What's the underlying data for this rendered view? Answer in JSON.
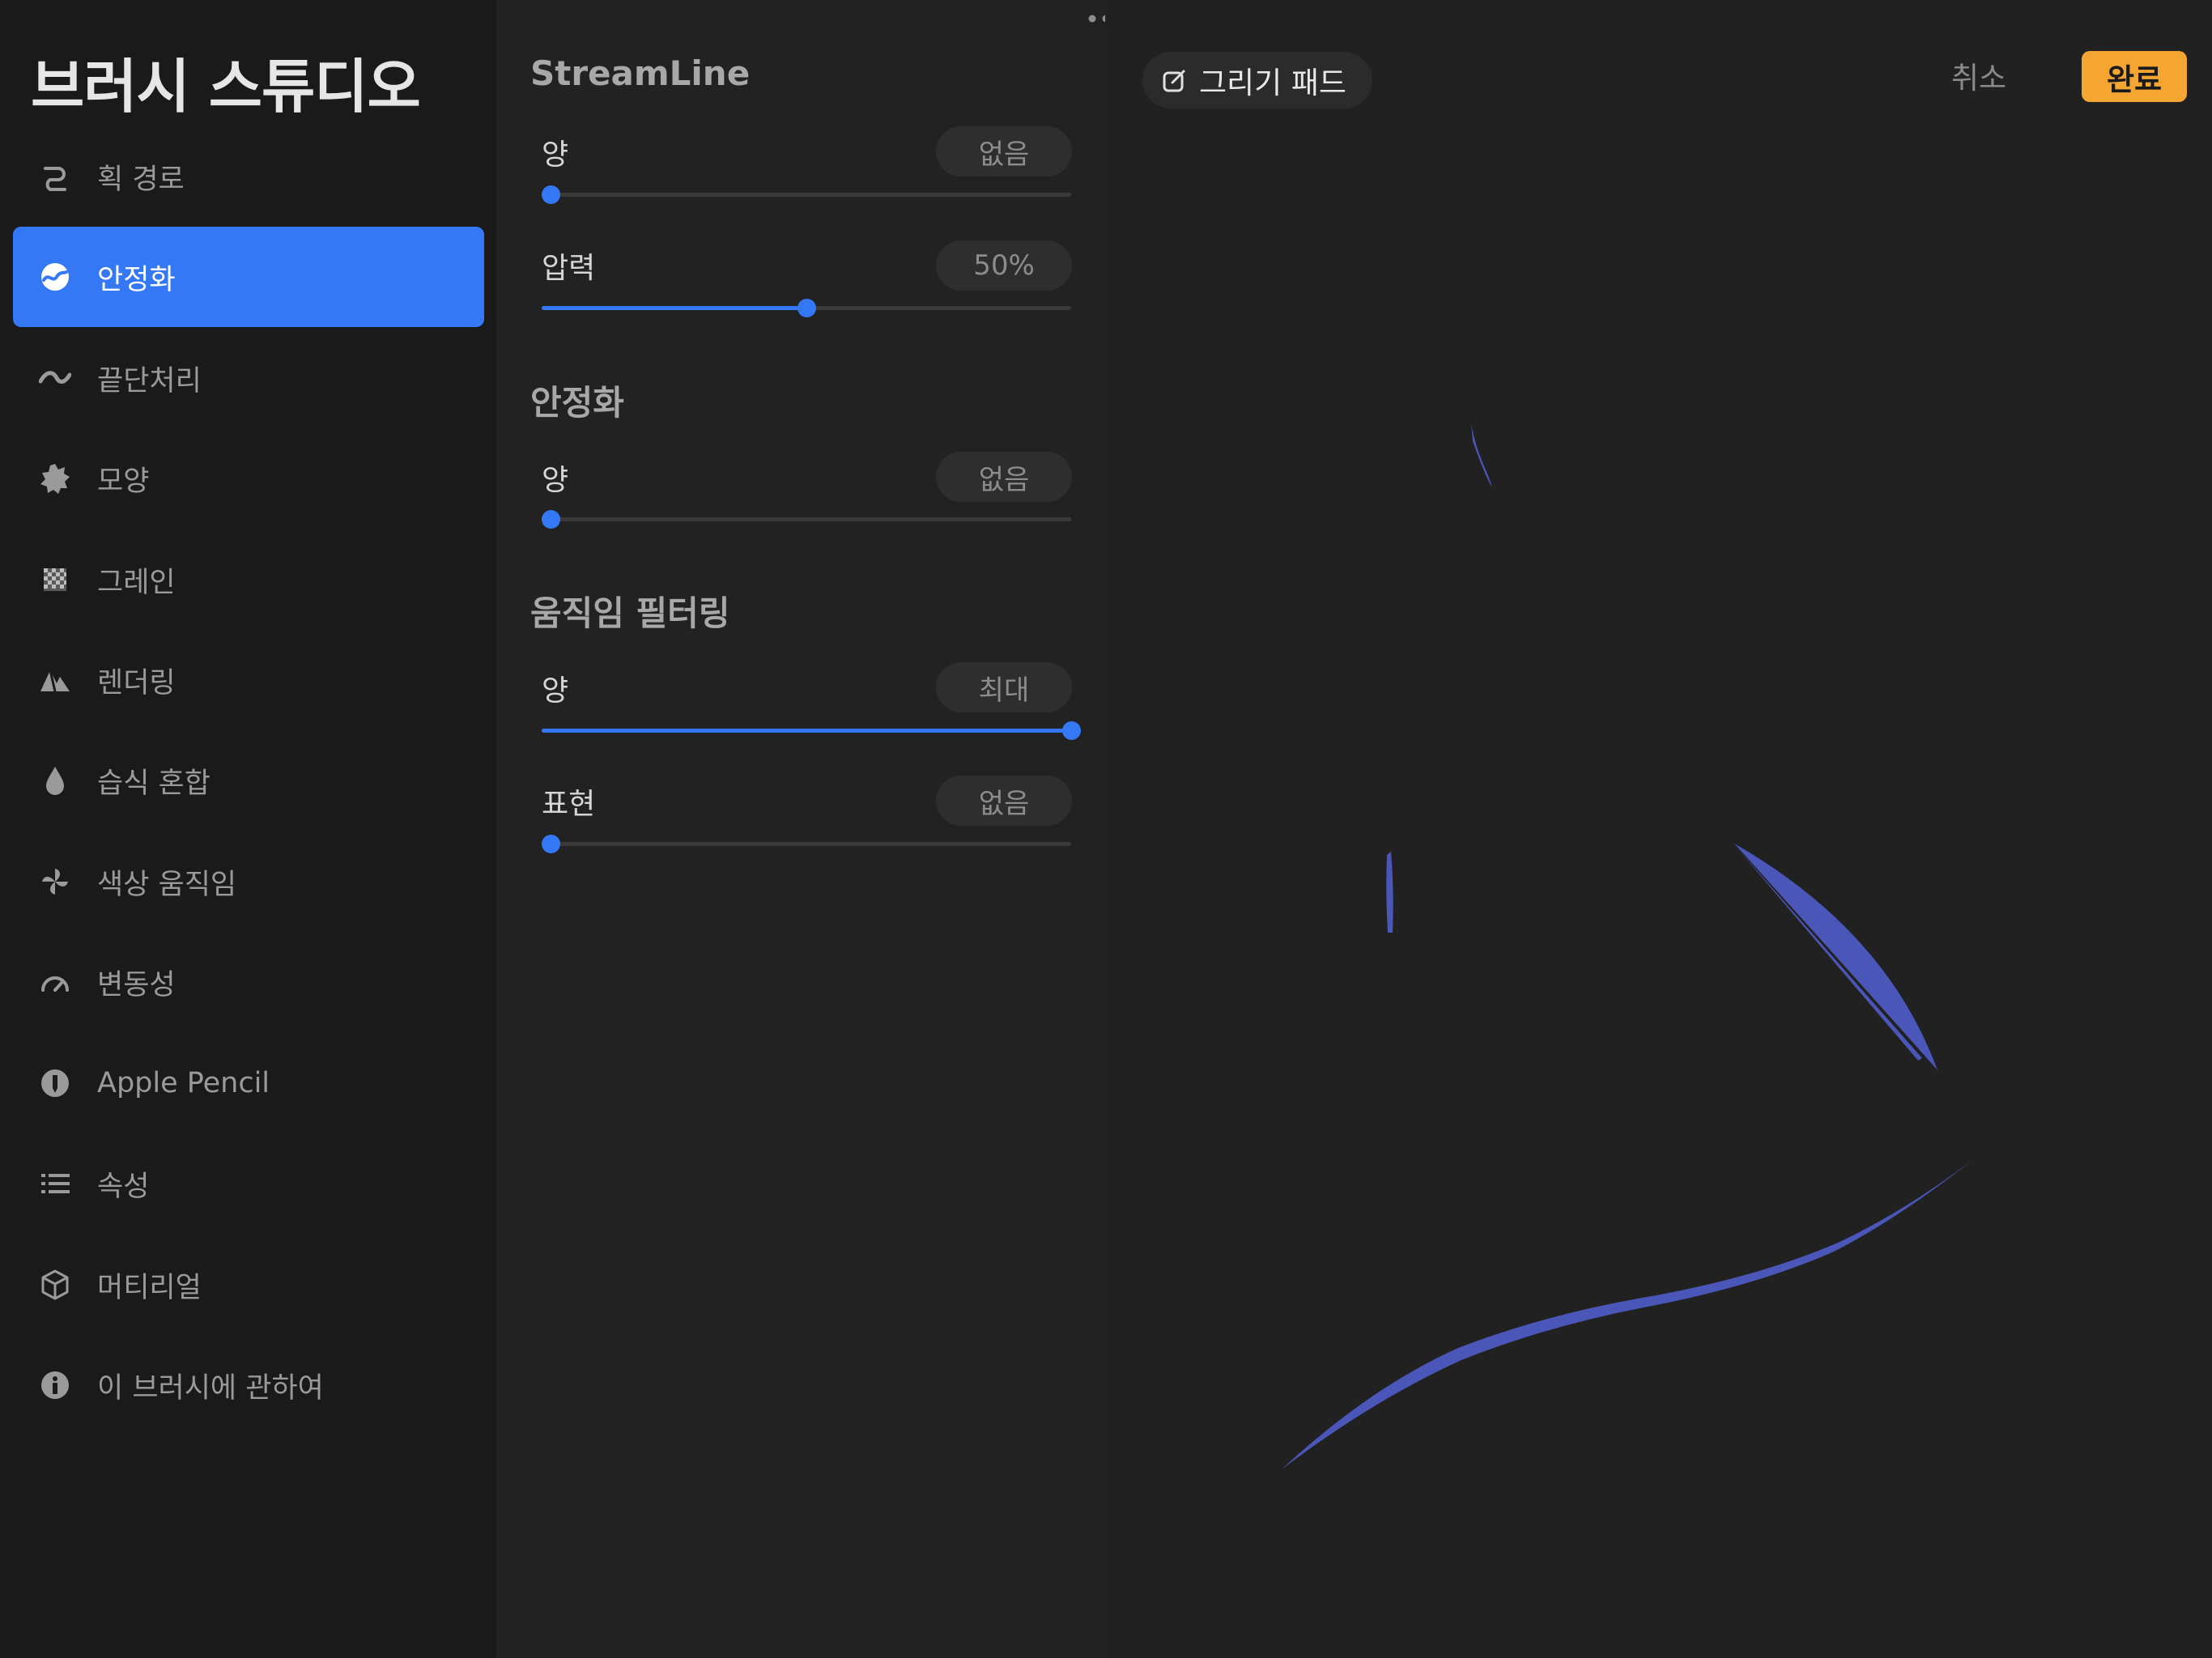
{
  "sidebar": {
    "title": "브러시 스튜디오",
    "items": [
      {
        "label": "획 경로",
        "icon": "stroke-path-icon"
      },
      {
        "label": "안정화",
        "icon": "stabilization-icon",
        "selected": true
      },
      {
        "label": "끝단처리",
        "icon": "taper-icon"
      },
      {
        "label": "모양",
        "icon": "shape-icon"
      },
      {
        "label": "그레인",
        "icon": "grain-icon"
      },
      {
        "label": "렌더링",
        "icon": "rendering-icon"
      },
      {
        "label": "습식 혼합",
        "icon": "wet-mix-icon"
      },
      {
        "label": "색상 움직임",
        "icon": "color-dynamics-icon"
      },
      {
        "label": "변동성",
        "icon": "dynamics-icon"
      },
      {
        "label": "Apple Pencil",
        "icon": "apple-pencil-icon"
      },
      {
        "label": "속성",
        "icon": "properties-icon"
      },
      {
        "label": "머티리얼",
        "icon": "materials-icon"
      },
      {
        "label": "이 브러시에 관하여",
        "icon": "info-icon"
      }
    ]
  },
  "settings": {
    "streamline": {
      "title": "StreamLine",
      "amount": {
        "label": "양",
        "value": "없음",
        "level": 0
      },
      "pressure": {
        "label": "압력",
        "value": "50%",
        "level": 0.5
      }
    },
    "stabilization": {
      "title": "안정화",
      "amount": {
        "label": "양",
        "value": "없음",
        "level": 0
      }
    },
    "motion_filtering": {
      "title": "움직임 필터링",
      "amount": {
        "label": "양",
        "value": "최대",
        "level": 1
      },
      "expression": {
        "label": "표현",
        "value": "없음",
        "level": 0
      }
    }
  },
  "drawing_pad": {
    "chip_label": "그리기 패드",
    "chip_icon": "edit-icon",
    "cancel_label": "취소",
    "done_label": "완료",
    "stroke_color": "#4a56b8"
  },
  "colors": {
    "accent": "#3478f6",
    "done": "#f5a531"
  }
}
